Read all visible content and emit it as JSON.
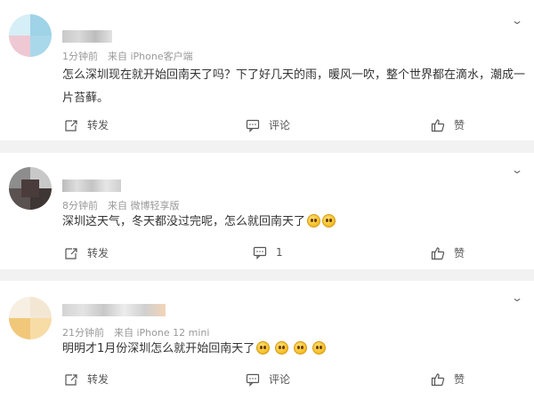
{
  "posts": [
    {
      "meta": "1分钟前　来自 iPhone客户端",
      "text": "怎么深圳现在就开始回南天了吗？下了好几天的雨，暖风一吹，整个世界都在滴水，潮成一片苔藓。",
      "emoji_count": 0,
      "actions": {
        "repost": "转发",
        "comment": "评论",
        "like": "赞"
      }
    },
    {
      "meta": "8分钟前　来自 微博轻享版",
      "text": "深圳这天气，冬天都没过完呢，怎么就回南天了",
      "emoji_count": 2,
      "actions": {
        "repost": "转发",
        "comment": "1",
        "like": "赞"
      }
    },
    {
      "meta": "21分钟前　来自 iPhone 12 mini",
      "text": "明明才1月份深圳怎么就开始回南天了",
      "emoji_count": 4,
      "actions": {
        "repost": "转发",
        "comment": "评论",
        "like": "赞"
      }
    }
  ],
  "icons": {
    "expand": "chevron-down-icon",
    "repost": "repost-icon",
    "comment": "comment-icon",
    "like": "thumbs-up-icon",
    "emoji": "dizzy-face-emoji"
  },
  "colors": {
    "background": "#f2f2f2",
    "card": "#ffffff",
    "meta_text": "#999999",
    "body_text": "#333333"
  }
}
